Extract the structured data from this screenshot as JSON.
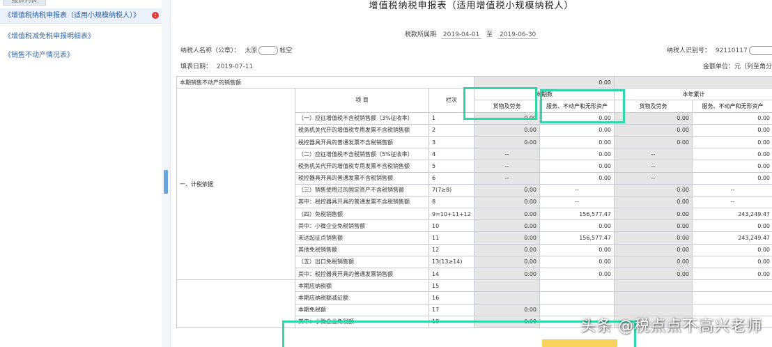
{
  "sidebar": {
    "tab_label": "报表列表",
    "items": [
      {
        "label": "《增值税纳税申报表（适用小规模纳税人）》",
        "badge": "!"
      },
      {
        "label": "《增值税减免税申报明细表》"
      },
      {
        "label": "《销售不动产情况表》"
      }
    ]
  },
  "form": {
    "title": "增值税纳税申报表（适用增值税小规模纳税人）",
    "period_label": "税款所属期",
    "period_start": "2019-04-01",
    "period_to": "至",
    "period_end": "2019-06-30",
    "taxpayer_name_label": "纳税人名称（公章）：",
    "taxpayer_name_prefix": "太原",
    "taxpayer_name_suffix": "帐空",
    "taxpayer_id_label": "纳税人识别号：",
    "taxpayer_id_value": "92110117",
    "fill_date_label": "填表日期：",
    "fill_date_value": "2019-07-11",
    "unit_label": "金额单位：元（列至角分）",
    "realestate_label": "本期销售不动产的销售额",
    "realestate_value": "0.00"
  },
  "table": {
    "header": {
      "item": "项 目",
      "column": "栏次",
      "current_period": "本期数",
      "year_total": "本年累计",
      "goods": "货物及劳务",
      "services": "服务、不动产和无形资产"
    },
    "section_label": "一、计税依据",
    "rows": [
      {
        "name": "（一）应征增值税不含税销售额（3%征收率）",
        "no": "1",
        "c1": "0.00",
        "c2": "0.00",
        "c3": "0.00",
        "c4": "0.00"
      },
      {
        "name": "税务机关代开的增值税专用发票不含税销售额",
        "no": "2",
        "c1": "0.00",
        "c2": "0.00",
        "c3": "0.00",
        "c4": "0.00"
      },
      {
        "name": "税控器具开具的普通发票不含税销售额",
        "no": "3",
        "c1": "0.00",
        "c2": "0.00",
        "c3": "0.00",
        "c4": "0.00"
      },
      {
        "name": "（二）应征增值税不含税销售额（5%征收率）",
        "no": "4",
        "c1": "--",
        "c2": "0.00",
        "c3": "--",
        "c4": "0.00"
      },
      {
        "name": "税务机关代开的增值税专用发票不含税销售额",
        "no": "5",
        "c1": "--",
        "c2": "0.00",
        "c3": "--",
        "c4": "0.00"
      },
      {
        "name": "税控器具开具的普通发票不含税销售额",
        "no": "6",
        "c1": "--",
        "c2": "0.00",
        "c3": "--",
        "c4": "0.00"
      },
      {
        "name": "（三）销售使用过的固定资产不含税销售额",
        "no": "7(7≥8)",
        "c1": "0.00",
        "c2": "--",
        "c3": "0.00",
        "c4": "--"
      },
      {
        "name": "其中：税控器具开具的普通发票不含税销售额",
        "no": "8",
        "c1": "0.00",
        "c2": "--",
        "c3": "0.00",
        "c4": "--"
      },
      {
        "name": "（四）免税销售额",
        "no": "9=10+11+12",
        "c1": "0.00",
        "c2": "156,577.47",
        "c3": "0.00",
        "c4": "243,249.47"
      },
      {
        "name": "其中：小微企业免税销售额",
        "no": "10",
        "c1": "0.00",
        "c2": "0.00",
        "c3": "0.00",
        "c4": "0.00"
      },
      {
        "name": "未达起征点销售额",
        "no": "11",
        "c1": "0.00",
        "c2": "156,577.47",
        "c3": "0.00",
        "c4": "243,249.47"
      },
      {
        "name": "其他免税销售额",
        "no": "12",
        "c1": "0.00",
        "c2": "0.00",
        "c3": "0.00",
        "c4": "0.00"
      },
      {
        "name": "（五）出口免税销售额",
        "no": "13(13≥14)",
        "c1": "0.00",
        "c2": "0.00",
        "c3": "0.00",
        "c4": "0.00"
      },
      {
        "name": "其中：税控器具开具的普通发票销售额",
        "no": "14",
        "c1": "0.00",
        "c2": "0.00",
        "c3": "0.00",
        "c4": "0.00"
      },
      {
        "name": "本期应纳税额",
        "no": "15",
        "c1": "",
        "c2": "",
        "c3": "",
        "c4": ""
      },
      {
        "name": "本期应纳税额减征额",
        "no": "16",
        "c1": "",
        "c2": "",
        "c3": "",
        "c4": ""
      },
      {
        "name": "本期免税额",
        "no": "17",
        "c1": "0.00",
        "c2": "",
        "c3": "",
        "c4": ""
      },
      {
        "name": "其中：小微企业免税额",
        "no": "18",
        "c1": "0.00",
        "c2": "",
        "c3": "",
        "c4": ""
      }
    ]
  },
  "watermark": "头条 @税点点不高兴老师"
}
